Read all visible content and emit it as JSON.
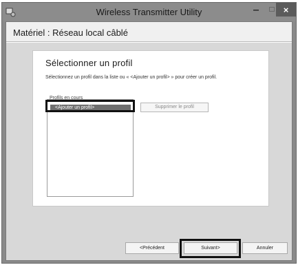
{
  "window": {
    "title": "Wireless Transmitter Utility",
    "icons": {
      "app": "app-icon",
      "minimize": "minimize-icon",
      "maximize": "maximize-icon",
      "close": "close-icon"
    },
    "close_glyph": "×"
  },
  "header": {
    "text": "Matériel : Réseau local câblé"
  },
  "panel": {
    "title": "Sélectionner un profil",
    "description": "Sélectionnez un profil dans la liste ou « <Ajouter un profil> » pour créer un profil.",
    "list_label": "Profils en cours",
    "list_items": [
      "<Ajouter un profil>"
    ],
    "delete_button": "Supprimer le profil"
  },
  "buttons": {
    "previous": "<Précédent",
    "next": "Suivant>",
    "cancel": "Annuler"
  },
  "colors": {
    "titlebar": "#8c8c8c",
    "close_button": "#5b5b5b",
    "content_background": "#d8d8d8",
    "selected_item": "#6e6e6e",
    "highlight_border": "#111111"
  }
}
